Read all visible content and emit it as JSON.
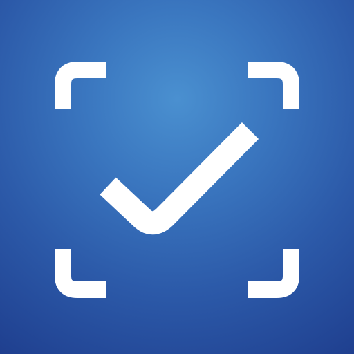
{
  "icon": {
    "name": "scan-check-app-icon",
    "glyph": "check-mark-icon",
    "frame": "scan-frame-corners-icon",
    "colors": {
      "foreground": "#ffffff",
      "background_center": "#4a90d0",
      "background_mid": "#2c5aa9",
      "background_edge": "#1f3f8f"
    }
  }
}
